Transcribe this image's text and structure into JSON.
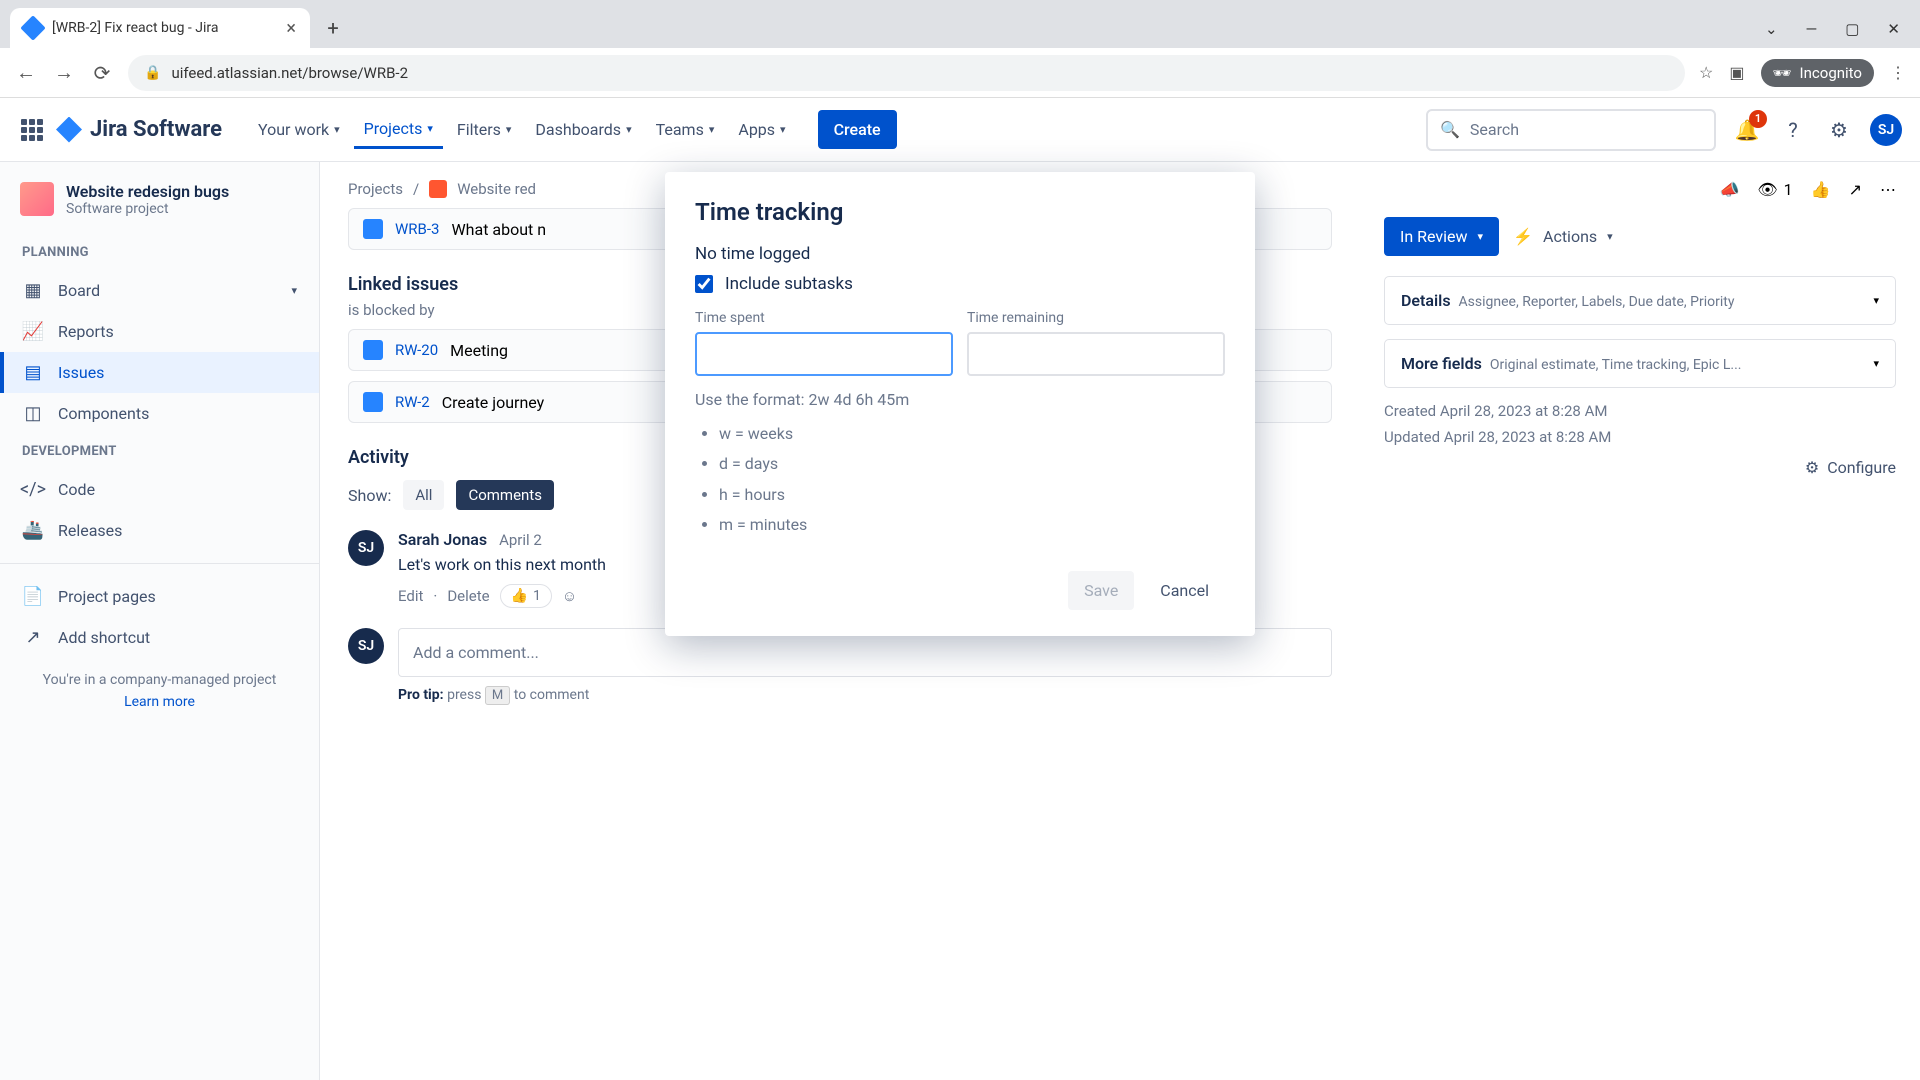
{
  "browser": {
    "tab_title": "[WRB-2] Fix react bug - Jira",
    "url": "uifeed.atlassian.net/browse/WRB-2",
    "incognito": "Incognito"
  },
  "header": {
    "logo": "Jira Software",
    "nav": [
      "Your work",
      "Projects",
      "Filters",
      "Dashboards",
      "Teams",
      "Apps"
    ],
    "active_nav": "Projects",
    "create": "Create",
    "search_placeholder": "Search",
    "notif_count": "1",
    "avatar": "SJ"
  },
  "sidebar": {
    "project": "Website redesign bugs",
    "project_sub": "Software project",
    "sections": {
      "planning": "PLANNING",
      "development": "DEVELOPMENT"
    },
    "items": {
      "board": "Board",
      "reports": "Reports",
      "issues": "Issues",
      "components": "Components",
      "code": "Code",
      "releases": "Releases",
      "pages": "Project pages",
      "shortcut": "Add shortcut"
    },
    "footer": "You're in a company-managed project",
    "learn": "Learn more"
  },
  "content": {
    "breadcrumb_project": "Projects",
    "breadcrumb_name": "Website red",
    "child_key": "WRB-3",
    "child_summary": "What about n",
    "linked_title": "Linked issues",
    "linked_sub": "is blocked by",
    "linked": [
      {
        "key": "RW-20",
        "summary": "Meeting"
      },
      {
        "key": "RW-2",
        "summary": "Create journey"
      }
    ],
    "activity": "Activity",
    "show": "Show:",
    "tabs": [
      "All",
      "Comments"
    ],
    "comment": {
      "author": "Sarah Jonas",
      "date": "April 2",
      "text": "Let's work on this next month",
      "edit": "Edit",
      "delete": "Delete",
      "reaction_count": "1"
    },
    "add_comment": "Add a comment...",
    "protip_label": "Pro tip:",
    "protip_press": "press",
    "protip_key": "M",
    "protip_rest": "to comment"
  },
  "right": {
    "watch_count": "1",
    "status": "In Review",
    "actions": "Actions",
    "details": "Details",
    "details_hint": "Assignee, Reporter, Labels, Due date, Priority",
    "more": "More fields",
    "more_hint": "Original estimate, Time tracking, Epic L...",
    "created": "Created April 28, 2023 at 8:28 AM",
    "updated": "Updated April 28, 2023 at 8:28 AM",
    "configure": "Configure"
  },
  "modal": {
    "title": "Time tracking",
    "no_time": "No time logged",
    "include": "Include subtasks",
    "spent_label": "Time spent",
    "remaining_label": "Time remaining",
    "format_hint": "Use the format: 2w 4d 6h 45m",
    "units": [
      "w = weeks",
      "d = days",
      "h = hours",
      "m = minutes"
    ],
    "save": "Save",
    "cancel": "Cancel"
  }
}
